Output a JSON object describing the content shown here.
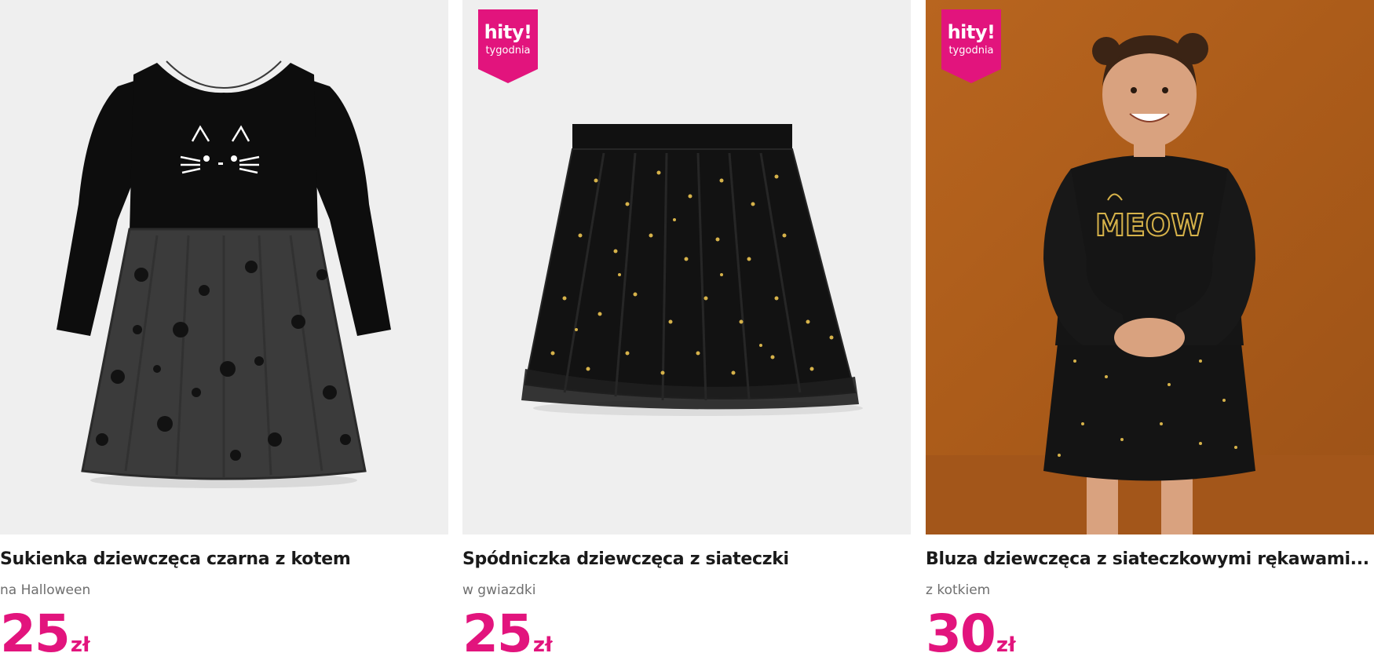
{
  "colors": {
    "accent": "#e2147d",
    "price": "#e2147d",
    "subtitle": "#6f6f6f",
    "image_bg": "#efefef",
    "photo_bg": "#b0601c"
  },
  "products": [
    {
      "image_icon": "dress-with-cat-face-icon",
      "badge": null,
      "title": "Sukienka dziewczęca czarna z kotem",
      "subtitle": "na Halloween",
      "price": "25",
      "currency": "zł"
    },
    {
      "image_icon": "tulle-skirt-with-stars-icon",
      "badge": {
        "main": "hity!",
        "sub": "tygodnia"
      },
      "title": "Spódniczka dziewczęca z siateczki",
      "subtitle": "w gwiazdki",
      "price": "25",
      "currency": "zł"
    },
    {
      "image_icon": "girl-in-meow-sweatshirt-icon",
      "badge": {
        "main": "hity!",
        "sub": "tygodnia"
      },
      "title": "Bluza dziewczęca z siateczkowymi rękawami...",
      "subtitle": "z kotkiem",
      "price": "30",
      "currency": "zł",
      "image_text": "MEOW"
    }
  ]
}
